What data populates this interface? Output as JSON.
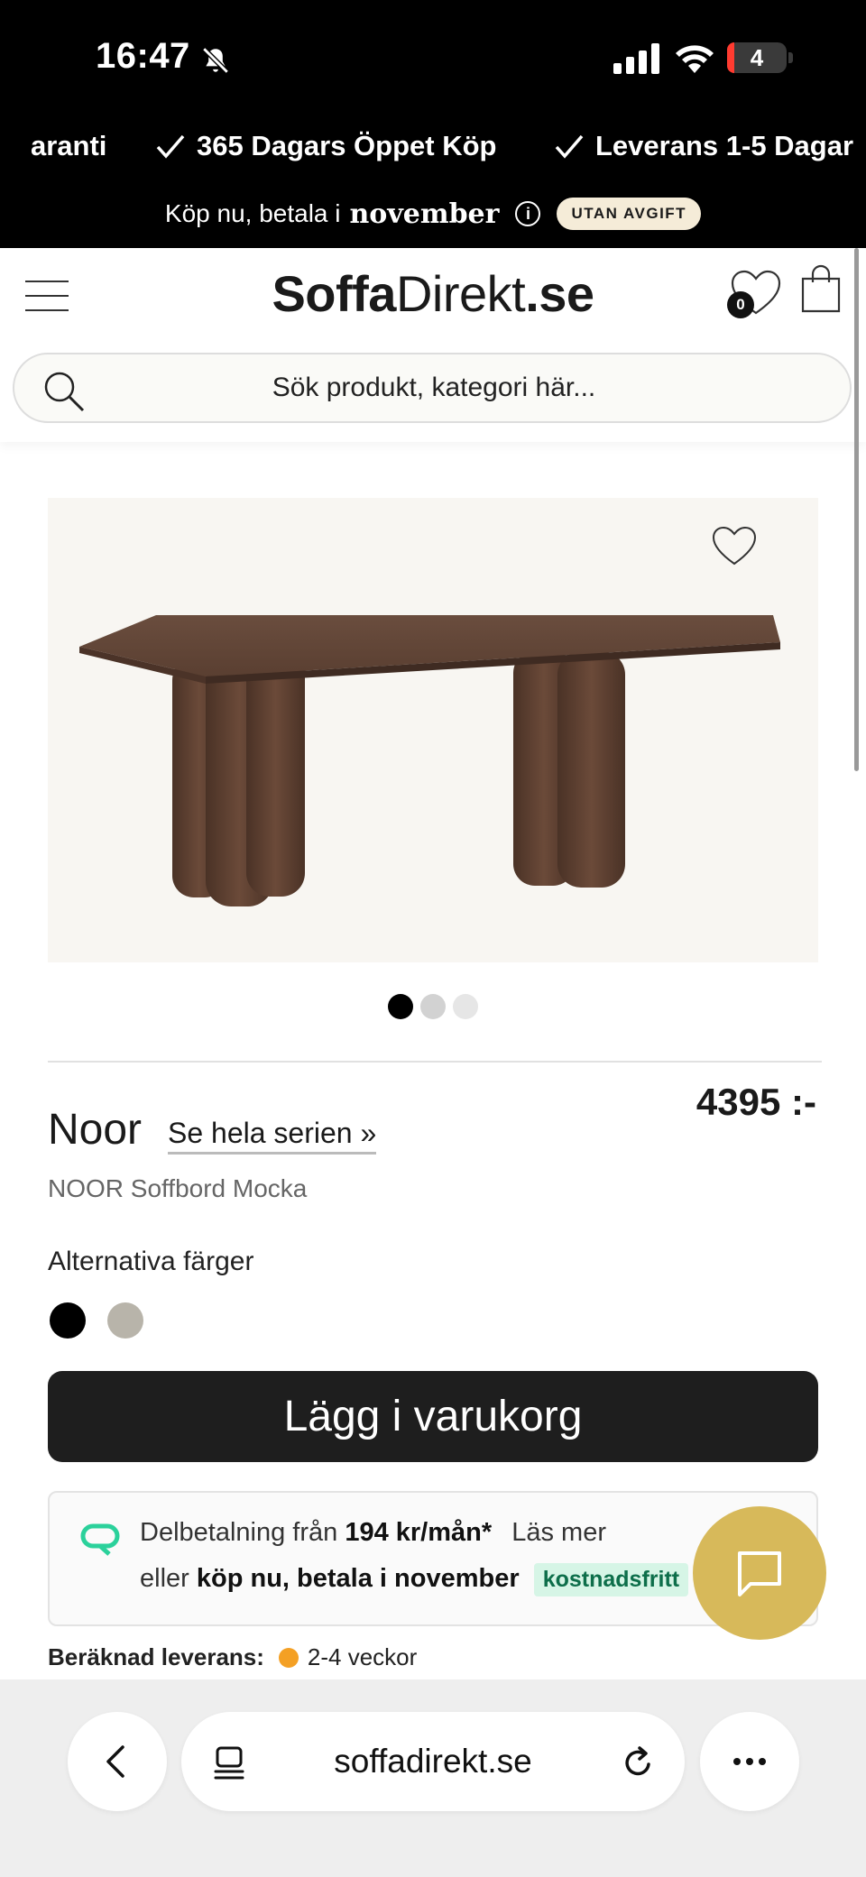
{
  "status_bar": {
    "time": "16:47",
    "battery": "4"
  },
  "promo": {
    "usps": [
      "aranti",
      "365 Dagars Öppet Köp",
      "Leverans 1-5 Dagar"
    ],
    "klarna_prefix": "Köp nu, betala i",
    "klarna_month": "november",
    "klarna_badge": "UTAN AVGIFT"
  },
  "header": {
    "logo_part1": "Soffa",
    "logo_part2": "Direkt",
    "logo_part3": ".se",
    "wishlist_count": "0",
    "search_placeholder": "Sök produkt, kategori här..."
  },
  "product": {
    "name": "Noor",
    "series_link": "Se hela serien »",
    "price": "4395 :-",
    "subtitle": "NOOR Soffbord Mocka",
    "alt_colors_label": "Alternativa färger",
    "alt_colors": [
      "#000000",
      "#b8b4aa"
    ],
    "image_index": 1,
    "image_count": 3,
    "add_to_cart": "Lägg i varukorg"
  },
  "payment": {
    "l1_prefix": "Delbetalning från",
    "l1_amount": "194 kr/mån*",
    "l1_link": "Läs mer",
    "l2_prefix": "eller",
    "l2_bold": "köp nu, betala i november",
    "l2_tag": "kostnadsfritt"
  },
  "delivery": {
    "label": "Beräknad leverans:",
    "value": "2-4 veckor",
    "status_color": "#f4a024"
  },
  "browser": {
    "url": "soffadirekt.se"
  },
  "colors": {
    "accent_chat": "#d7b95a",
    "cart_button": "#1e1e1e",
    "klarna_green": "#0d6e4a"
  }
}
